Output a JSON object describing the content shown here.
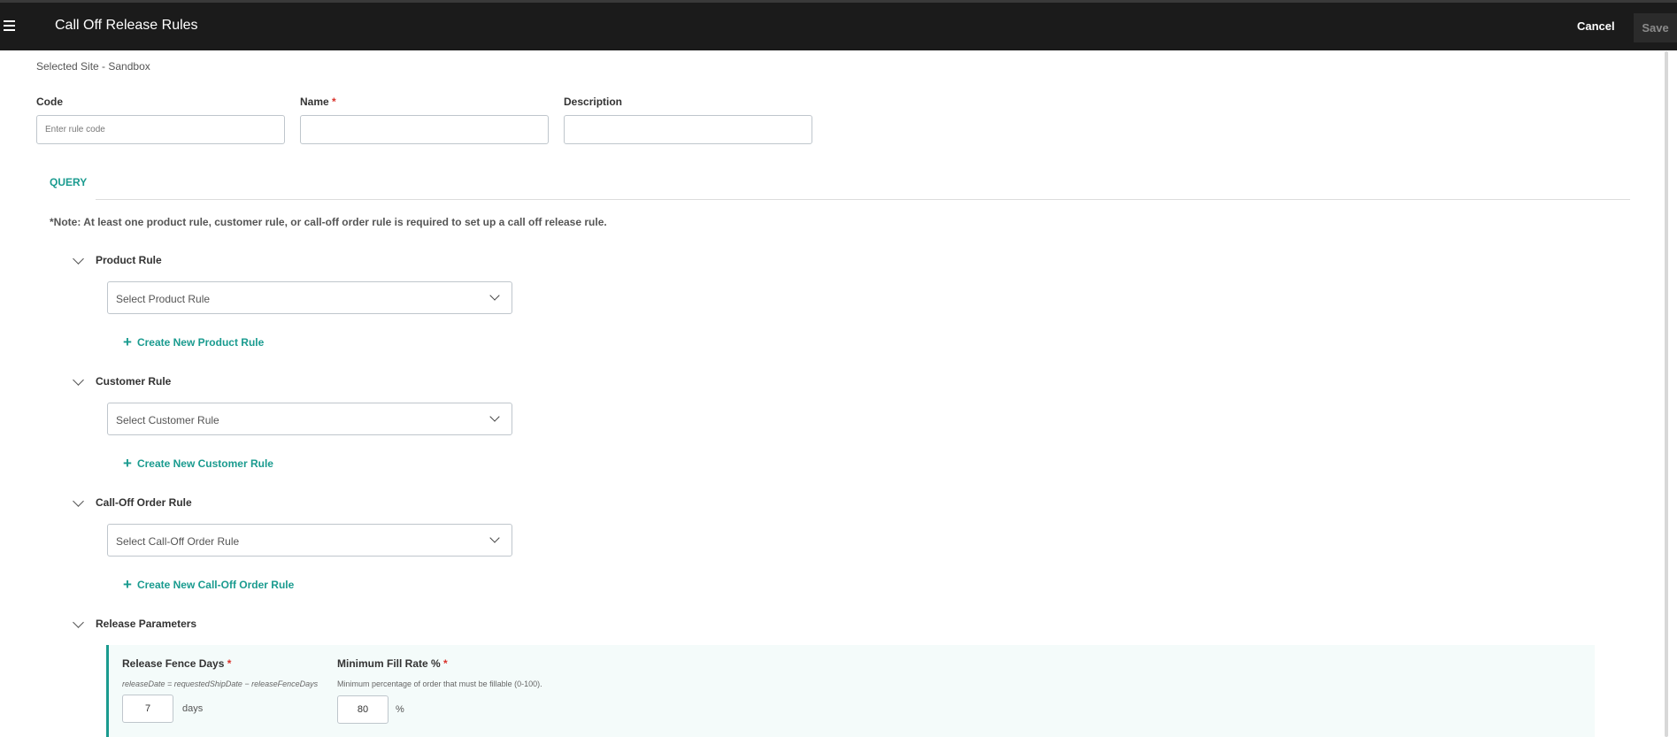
{
  "header": {
    "title": "Call Off Release Rules",
    "cancel_label": "Cancel",
    "save_label": "Save"
  },
  "site": {
    "label": "Selected Site - Sandbox"
  },
  "form": {
    "code": {
      "label": "Code",
      "placeholder": "Enter rule code",
      "value": ""
    },
    "name": {
      "label": "Name",
      "required_mark": "*",
      "value": ""
    },
    "description": {
      "label": "Description",
      "value": ""
    }
  },
  "query": {
    "tab_label": "QUERY",
    "note": "*Note: At least one product rule, customer rule, or call-off order rule is required to set up a call off release rule."
  },
  "sections": {
    "product": {
      "title": "Product Rule",
      "select_placeholder": "Select Product Rule",
      "create_label": "Create New Product Rule"
    },
    "customer": {
      "title": "Customer Rule",
      "select_placeholder": "Select Customer Rule",
      "create_label": "Create New Customer Rule"
    },
    "calloff": {
      "title": "Call-Off Order Rule",
      "select_placeholder": "Select Call-Off Order Rule",
      "create_label": "Create New Call-Off Order Rule"
    },
    "release": {
      "title": "Release Parameters"
    }
  },
  "release_params": {
    "fence_days": {
      "label": "Release Fence Days",
      "required_mark": "*",
      "help": "releaseDate = requestedShipDate − releaseFenceDays",
      "value": "7",
      "unit": "days"
    },
    "fill_rate": {
      "label": "Minimum Fill Rate %",
      "required_mark": "*",
      "help": "Minimum percentage of order that must be fillable (0-100).",
      "value": "80",
      "unit": "%"
    }
  },
  "icons": {
    "menu": "hamburger-icon",
    "chevron": "chevron-down-icon",
    "plus": "plus-icon"
  },
  "colors": {
    "header_bg": "#1b1b1b",
    "accent": "#1a9b8f",
    "required": "#d9322b"
  }
}
